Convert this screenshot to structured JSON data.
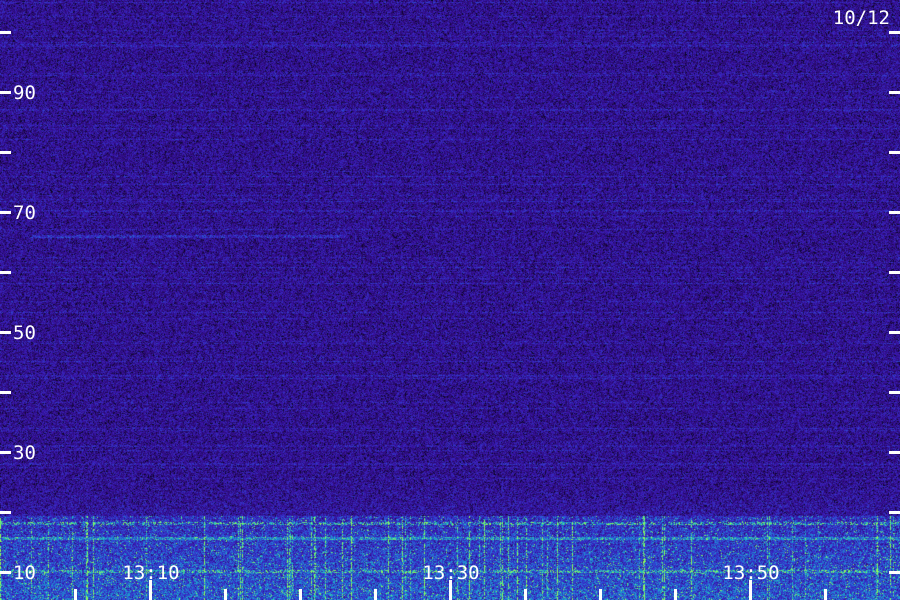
{
  "chart_data": {
    "type": "heatmap",
    "title": "",
    "date_label": "10/12",
    "xlabel": "",
    "ylabel": "",
    "x_tick_labels": [
      "13:10",
      "13:30",
      "13:50"
    ],
    "y_tick_labels": [
      "10",
      "30",
      "50",
      "70",
      "90"
    ],
    "ylim": [
      0,
      100
    ],
    "y_major_ticks": [
      10,
      30,
      50,
      70,
      90
    ],
    "y_minor_ticks": [
      0,
      20,
      40,
      60,
      80,
      100
    ],
    "xlim_minutes": [
      "13:00",
      "13:58"
    ],
    "x_major_ticks": [
      "13:10",
      "13:30",
      "13:50"
    ],
    "x_minor_ticks": [
      "13:05",
      "13:15",
      "13:20",
      "13:25",
      "13:35",
      "13:40",
      "13:45",
      "13:55"
    ],
    "grid": false,
    "colormap": [
      "#0a0520",
      "#2a0a70",
      "#3a18b0",
      "#2e4cd8",
      "#18b8c8",
      "#8cff5a"
    ],
    "description_bands": [
      {
        "freq": 5,
        "intensity": "high"
      },
      {
        "freq": 66,
        "intensity": "medium",
        "until": "13:22"
      }
    ]
  }
}
